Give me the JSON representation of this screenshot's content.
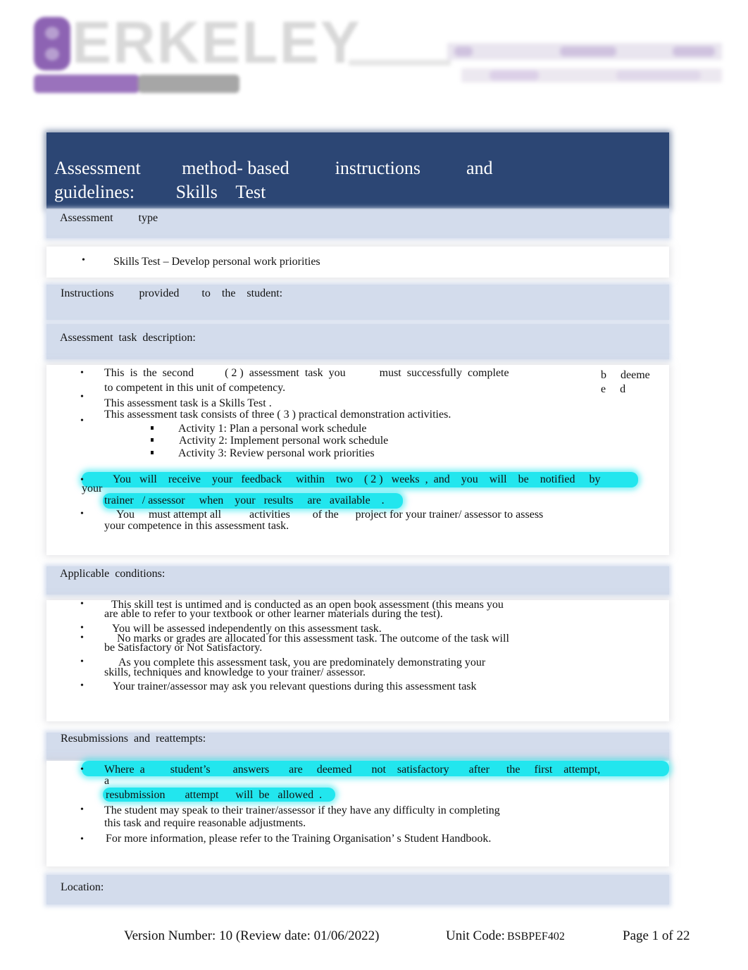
{
  "header": {
    "logo_text": "ERKELEY",
    "logo_initial": "B"
  },
  "title": {
    "line1": "Assessment         method- based          instructions          and",
    "line2": "guidelines:         Skills    Test"
  },
  "sections": {
    "assessment_type": {
      "heading": "Assessment         type",
      "items": [
        "Skills Test – Develop personal work priorities"
      ]
    },
    "instructions": {
      "heading": "Instructions         provided        to    the    student:"
    },
    "task_description": {
      "heading": "Assessment  task  description:",
      "item1_line1": "This  is  the  second           ( 2 )  assessment  task  you            must  successfully  complete",
      "item1_side1": "b     deeme",
      "item1_side2": "e     d",
      "item1_line2": "to competent in this unit of competency.",
      "item2": "This assessment task is a Skills Test .",
      "item3": "This assessment task consists of three ( 3 ) practical demonstration activities.",
      "activities": [
        "Activity 1: Plan a personal work schedule",
        "Activity 2: Implement personal work schedule",
        "Activity 3: Review personal work priorities"
      ],
      "feedback_line1": "You   will    receive    your   feedback     within    two    ( 2 )   weeks  ,  and    you    will    be    notified     by",
      "feedback_line1b": "your",
      "feedback_line2": "trainer   / assessor     when    your   results     are   available    .",
      "attempt_line1": "You     must attempt all          activities        of the      project for your trainer/ assessor to assess",
      "attempt_line2": "your competence in this assessment task."
    },
    "conditions": {
      "heading": "Applicable  conditions:",
      "items": [
        [
          "This skill test is untimed and is conducted as an open book assessment (this means you",
          "are able to refer to your textbook or other learner materials during the test)."
        ],
        [
          "You will be assessed independently on this assessment task."
        ],
        [
          "No marks or grades are allocated for this assessment task. The outcome of the task will",
          "be Satisfactory or Not Satisfactory."
        ],
        [
          "As you complete this assessment task, you are predominately demonstrating your",
          "skills, techniques and knowledge to your trainer/ assessor."
        ],
        [
          "Your trainer/assessor may ask you relevant questions during this assessment task"
        ]
      ]
    },
    "resubmissions": {
      "heading": "Resubmissions  and  reattempts:",
      "hl_line1": "Where  a         student’s        answers       are     deemed       not    satisfactory       after      the     first    attempt,",
      "hl_line1b": "a",
      "hl_line2": "resubmission       attempt      will  be   allowed  .",
      "item2_line1": "The student may speak to their trainer/assessor if they have any difficulty in completing",
      "item2_line2": "this task and require reasonable adjustments.",
      "item3": "For more information, please refer to the Training Organisation’ s Student Handbook."
    },
    "location": {
      "heading": "Location:"
    }
  },
  "footer": {
    "version": "Version Number: 10 (Review date: 01/06/2022)",
    "unit_label": "Unit Code:",
    "unit_code": "BSBPEF402",
    "page": "Page 1 of 22"
  },
  "colors": {
    "title_band": "#2c4674",
    "section_band": "#d3dcec",
    "highlight": "#22e6ee",
    "logo_purple": "#8d63b3"
  }
}
